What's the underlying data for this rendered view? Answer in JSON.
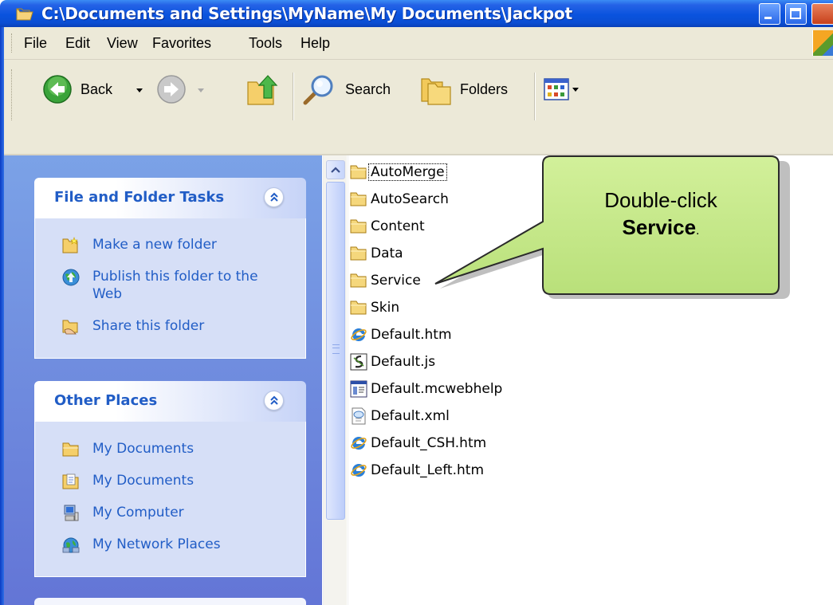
{
  "window": {
    "title": "C:\\Documents and Settings\\MyName\\My Documents\\Jackpot",
    "colors": {
      "titlebar": "#0a53de",
      "left_panel": "#6f8edb",
      "task_link": "#215dc6",
      "callout_fill": "#c8ea8c"
    }
  },
  "menu": [
    {
      "label": "File"
    },
    {
      "label": "Edit"
    },
    {
      "label": "View"
    },
    {
      "label": "Favorites"
    },
    {
      "label": "Tools"
    },
    {
      "label": "Help"
    }
  ],
  "toolbar": {
    "back_label": "Back",
    "search_label": "Search",
    "folders_label": "Folders"
  },
  "tasks_panel": {
    "title": "File and Folder Tasks",
    "items": [
      {
        "label": "Make a new folder",
        "icon": "new-folder-icon"
      },
      {
        "label": "Publish this folder to the Web",
        "icon": "publish-web-icon"
      },
      {
        "label": "Share this folder",
        "icon": "share-folder-icon"
      }
    ]
  },
  "places_panel": {
    "title": "Other Places",
    "items": [
      {
        "label": "My Documents",
        "icon": "folder-icon"
      },
      {
        "label": "My Documents",
        "icon": "shared-documents-icon"
      },
      {
        "label": "My Computer",
        "icon": "computer-icon"
      },
      {
        "label": "My Network Places",
        "icon": "network-icon"
      }
    ]
  },
  "files": [
    {
      "name": "AutoMerge",
      "type": "folder",
      "selected": true
    },
    {
      "name": "AutoSearch",
      "type": "folder"
    },
    {
      "name": "Content",
      "type": "folder"
    },
    {
      "name": "Data",
      "type": "folder"
    },
    {
      "name": "Service",
      "type": "folder"
    },
    {
      "name": "Skin",
      "type": "folder"
    },
    {
      "name": "Default.htm",
      "type": "ie-html"
    },
    {
      "name": "Default.js",
      "type": "script"
    },
    {
      "name": "Default.mcwebhelp",
      "type": "webhelp"
    },
    {
      "name": "Default.xml",
      "type": "xml"
    },
    {
      "name": "Default_CSH.htm",
      "type": "ie-html"
    },
    {
      "name": "Default_Left.htm",
      "type": "ie-html"
    }
  ],
  "callout": {
    "line1": "Double-click",
    "bold": "Service",
    "suffix": "."
  }
}
